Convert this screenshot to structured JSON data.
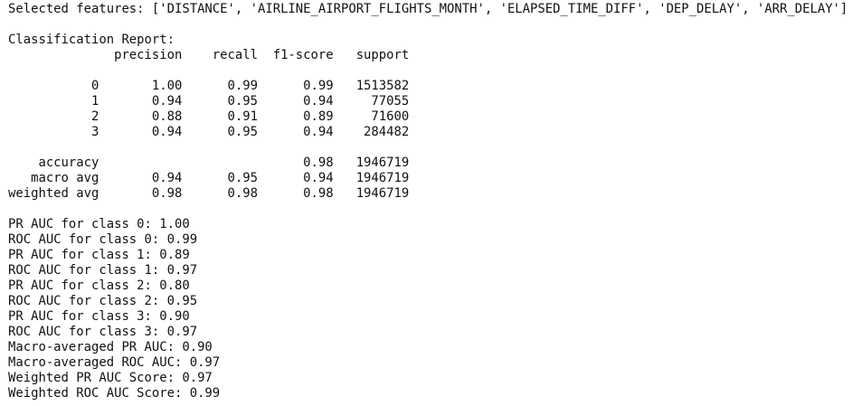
{
  "console": {
    "lines": [
      "Selected features: ['DISTANCE', 'AIRLINE_AIRPORT_FLIGHTS_MONTH', 'ELAPSED_TIME_DIFF', 'DEP_DELAY', 'ARR_DELAY']",
      "",
      "Classification Report:",
      "              precision    recall  f1-score   support",
      "",
      "           0       1.00      0.99      0.99   1513582",
      "           1       0.94      0.95      0.94     77055",
      "           2       0.88      0.91      0.89     71600",
      "           3       0.94      0.95      0.94    284482",
      "",
      "    accuracy                           0.98   1946719",
      "   macro avg       0.94      0.95      0.94   1946719",
      "weighted avg       0.98      0.98      0.98   1946719",
      "",
      "PR AUC for class 0: 1.00",
      "ROC AUC for class 0: 0.99",
      "PR AUC for class 1: 0.89",
      "ROC AUC for class 1: 0.97",
      "PR AUC for class 2: 0.80",
      "ROC AUC for class 2: 0.95",
      "PR AUC for class 3: 0.90",
      "ROC AUC for class 3: 0.97",
      "Macro-averaged PR AUC: 0.90",
      "Macro-averaged ROC AUC: 0.97",
      "Weighted PR AUC Score: 0.97",
      "Weighted ROC AUC Score: 0.99"
    ]
  }
}
